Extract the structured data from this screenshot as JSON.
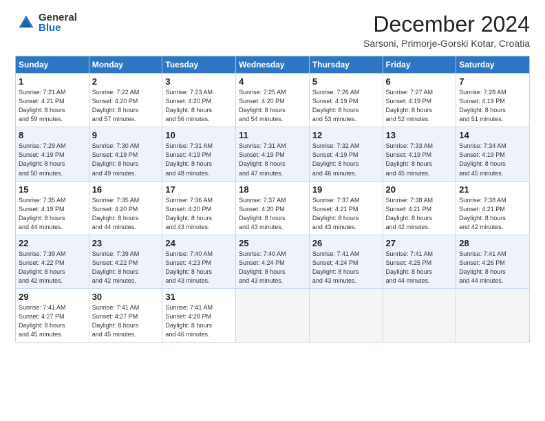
{
  "logo": {
    "general": "General",
    "blue": "Blue"
  },
  "title": "December 2024",
  "location": "Sarsoni, Primorje-Gorski Kotar, Croatia",
  "headers": [
    "Sunday",
    "Monday",
    "Tuesday",
    "Wednesday",
    "Thursday",
    "Friday",
    "Saturday"
  ],
  "weeks": [
    [
      {
        "day": "1",
        "lines": [
          "Sunrise: 7:21 AM",
          "Sunset: 4:21 PM",
          "Daylight: 8 hours",
          "and 59 minutes."
        ]
      },
      {
        "day": "2",
        "lines": [
          "Sunrise: 7:22 AM",
          "Sunset: 4:20 PM",
          "Daylight: 8 hours",
          "and 57 minutes."
        ]
      },
      {
        "day": "3",
        "lines": [
          "Sunrise: 7:23 AM",
          "Sunset: 4:20 PM",
          "Daylight: 8 hours",
          "and 56 minutes."
        ]
      },
      {
        "day": "4",
        "lines": [
          "Sunrise: 7:25 AM",
          "Sunset: 4:20 PM",
          "Daylight: 8 hours",
          "and 54 minutes."
        ]
      },
      {
        "day": "5",
        "lines": [
          "Sunrise: 7:26 AM",
          "Sunset: 4:19 PM",
          "Daylight: 8 hours",
          "and 53 minutes."
        ]
      },
      {
        "day": "6",
        "lines": [
          "Sunrise: 7:27 AM",
          "Sunset: 4:19 PM",
          "Daylight: 8 hours",
          "and 52 minutes."
        ]
      },
      {
        "day": "7",
        "lines": [
          "Sunrise: 7:28 AM",
          "Sunset: 4:19 PM",
          "Daylight: 8 hours",
          "and 51 minutes."
        ]
      }
    ],
    [
      {
        "day": "8",
        "lines": [
          "Sunrise: 7:29 AM",
          "Sunset: 4:19 PM",
          "Daylight: 8 hours",
          "and 50 minutes."
        ]
      },
      {
        "day": "9",
        "lines": [
          "Sunrise: 7:30 AM",
          "Sunset: 4:19 PM",
          "Daylight: 8 hours",
          "and 49 minutes."
        ]
      },
      {
        "day": "10",
        "lines": [
          "Sunrise: 7:31 AM",
          "Sunset: 4:19 PM",
          "Daylight: 8 hours",
          "and 48 minutes."
        ]
      },
      {
        "day": "11",
        "lines": [
          "Sunrise: 7:31 AM",
          "Sunset: 4:19 PM",
          "Daylight: 8 hours",
          "and 47 minutes."
        ]
      },
      {
        "day": "12",
        "lines": [
          "Sunrise: 7:32 AM",
          "Sunset: 4:19 PM",
          "Daylight: 8 hours",
          "and 46 minutes."
        ]
      },
      {
        "day": "13",
        "lines": [
          "Sunrise: 7:33 AM",
          "Sunset: 4:19 PM",
          "Daylight: 8 hours",
          "and 45 minutes."
        ]
      },
      {
        "day": "14",
        "lines": [
          "Sunrise: 7:34 AM",
          "Sunset: 4:19 PM",
          "Daylight: 8 hours",
          "and 45 minutes."
        ]
      }
    ],
    [
      {
        "day": "15",
        "lines": [
          "Sunrise: 7:35 AM",
          "Sunset: 4:19 PM",
          "Daylight: 8 hours",
          "and 44 minutes."
        ]
      },
      {
        "day": "16",
        "lines": [
          "Sunrise: 7:35 AM",
          "Sunset: 4:20 PM",
          "Daylight: 8 hours",
          "and 44 minutes."
        ]
      },
      {
        "day": "17",
        "lines": [
          "Sunrise: 7:36 AM",
          "Sunset: 4:20 PM",
          "Daylight: 8 hours",
          "and 43 minutes."
        ]
      },
      {
        "day": "18",
        "lines": [
          "Sunrise: 7:37 AM",
          "Sunset: 4:20 PM",
          "Daylight: 8 hours",
          "and 43 minutes."
        ]
      },
      {
        "day": "19",
        "lines": [
          "Sunrise: 7:37 AM",
          "Sunset: 4:21 PM",
          "Daylight: 8 hours",
          "and 43 minutes."
        ]
      },
      {
        "day": "20",
        "lines": [
          "Sunrise: 7:38 AM",
          "Sunset: 4:21 PM",
          "Daylight: 8 hours",
          "and 42 minutes."
        ]
      },
      {
        "day": "21",
        "lines": [
          "Sunrise: 7:38 AM",
          "Sunset: 4:21 PM",
          "Daylight: 8 hours",
          "and 42 minutes."
        ]
      }
    ],
    [
      {
        "day": "22",
        "lines": [
          "Sunrise: 7:39 AM",
          "Sunset: 4:22 PM",
          "Daylight: 8 hours",
          "and 42 minutes."
        ]
      },
      {
        "day": "23",
        "lines": [
          "Sunrise: 7:39 AM",
          "Sunset: 4:22 PM",
          "Daylight: 8 hours",
          "and 42 minutes."
        ]
      },
      {
        "day": "24",
        "lines": [
          "Sunrise: 7:40 AM",
          "Sunset: 4:23 PM",
          "Daylight: 8 hours",
          "and 43 minutes."
        ]
      },
      {
        "day": "25",
        "lines": [
          "Sunrise: 7:40 AM",
          "Sunset: 4:24 PM",
          "Daylight: 8 hours",
          "and 43 minutes."
        ]
      },
      {
        "day": "26",
        "lines": [
          "Sunrise: 7:41 AM",
          "Sunset: 4:24 PM",
          "Daylight: 8 hours",
          "and 43 minutes."
        ]
      },
      {
        "day": "27",
        "lines": [
          "Sunrise: 7:41 AM",
          "Sunset: 4:25 PM",
          "Daylight: 8 hours",
          "and 44 minutes."
        ]
      },
      {
        "day": "28",
        "lines": [
          "Sunrise: 7:41 AM",
          "Sunset: 4:26 PM",
          "Daylight: 8 hours",
          "and 44 minutes."
        ]
      }
    ],
    [
      {
        "day": "29",
        "lines": [
          "Sunrise: 7:41 AM",
          "Sunset: 4:27 PM",
          "Daylight: 8 hours",
          "and 45 minutes."
        ]
      },
      {
        "day": "30",
        "lines": [
          "Sunrise: 7:41 AM",
          "Sunset: 4:27 PM",
          "Daylight: 8 hours",
          "and 45 minutes."
        ]
      },
      {
        "day": "31",
        "lines": [
          "Sunrise: 7:41 AM",
          "Sunset: 4:28 PM",
          "Daylight: 8 hours",
          "and 46 minutes."
        ]
      },
      {
        "day": "",
        "lines": []
      },
      {
        "day": "",
        "lines": []
      },
      {
        "day": "",
        "lines": []
      },
      {
        "day": "",
        "lines": []
      }
    ]
  ]
}
